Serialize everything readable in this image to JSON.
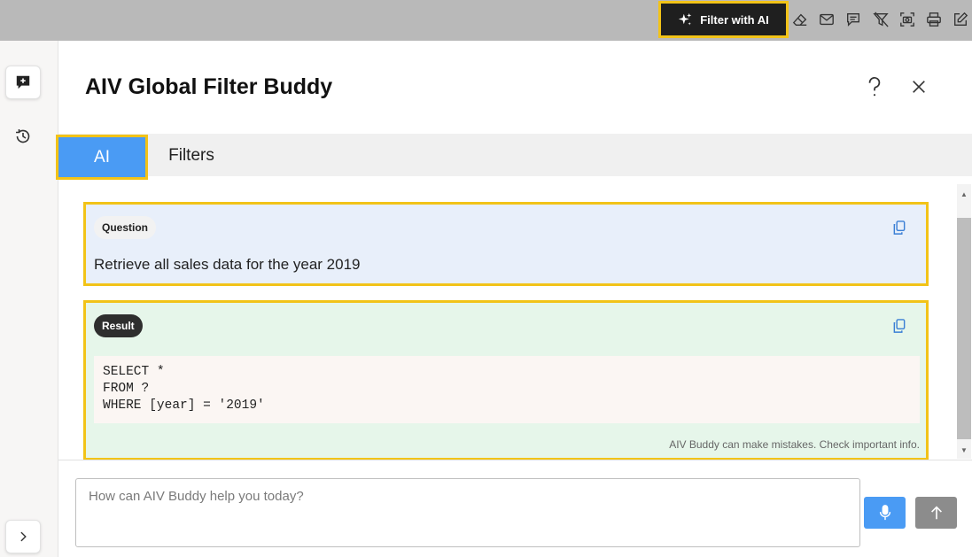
{
  "toolbar": {
    "filter_ai_label": "Filter with AI",
    "icons": [
      "eraser-icon",
      "mail-icon",
      "comment-icon",
      "clear-filter-icon",
      "screenshot-icon",
      "print-icon",
      "edit-icon"
    ]
  },
  "rail": {
    "icons": [
      "new-chat-icon",
      "history-icon",
      "expand-icon"
    ]
  },
  "panel": {
    "title": "AIV Global Filter Buddy",
    "tabs": [
      {
        "label": "AI",
        "active": true
      },
      {
        "label": "Filters",
        "active": false
      }
    ]
  },
  "question": {
    "chip": "Question",
    "text": "Retrieve all sales data for the year 2019"
  },
  "result": {
    "chip": "Result",
    "code": "SELECT *\nFROM ?\nWHERE [year] = '2019'",
    "disclaimer": "AIV Buddy can make mistakes. Check important info."
  },
  "input": {
    "placeholder": "How can AIV Buddy help you today?",
    "value": ""
  },
  "colors": {
    "accent": "#4a9bf4",
    "highlight": "#f2c318",
    "question_bg": "#e8effa",
    "result_bg": "#e6f6ea",
    "toolbar_bg": "#b9b9b9"
  }
}
